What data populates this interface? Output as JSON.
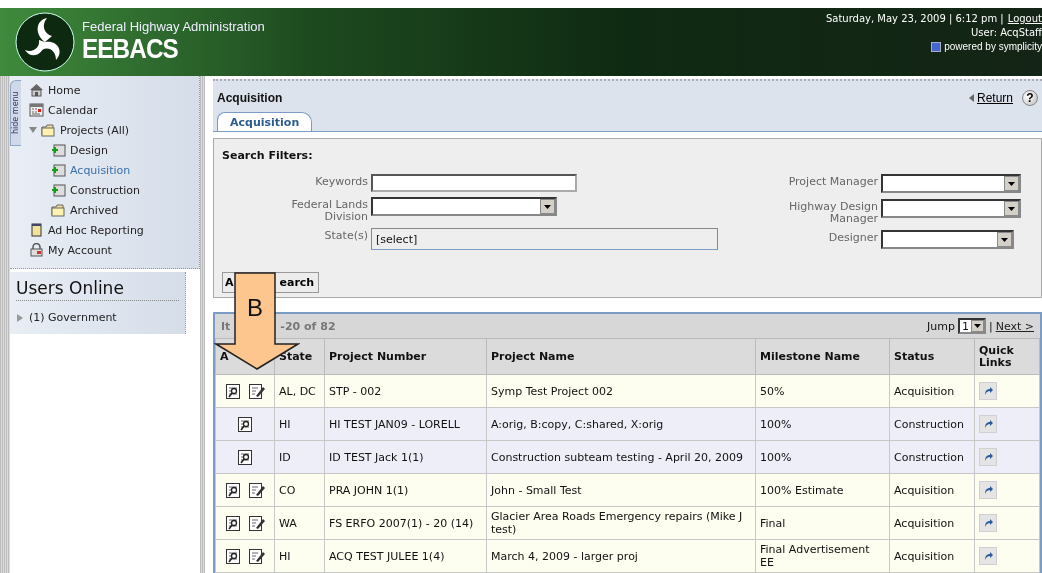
{
  "header": {
    "agency": "Federal Highway Administration",
    "app_name": "EEBACS",
    "datetime": "Saturday, May 23, 2009 | 6:12 pm |",
    "logout": "Logout",
    "user": "User: AcqStaff",
    "powered_by": "powered by symplicity"
  },
  "sidebar": {
    "hide_tab": "hide menu",
    "items": [
      {
        "label": "Home",
        "kind": "home",
        "selected": false
      },
      {
        "label": "Calendar",
        "kind": "calendar",
        "selected": false
      },
      {
        "label": "Projects (All)",
        "kind": "folder",
        "selected": false,
        "expanded": true,
        "children": [
          {
            "label": "Design",
            "kind": "add",
            "selected": false
          },
          {
            "label": "Acquisition",
            "kind": "add",
            "selected": true
          },
          {
            "label": "Construction",
            "kind": "add",
            "selected": false
          },
          {
            "label": "Archived",
            "kind": "folder",
            "selected": false
          }
        ]
      },
      {
        "label": "Ad Hoc Reporting",
        "kind": "notepad",
        "selected": false
      },
      {
        "label": "My Account",
        "kind": "lock",
        "selected": false
      }
    ],
    "users_online": {
      "title": "Users Online",
      "groups": [
        {
          "label": "(1) Government",
          "expanded": false
        }
      ]
    }
  },
  "page": {
    "title": "Acquisition",
    "return_link": "Return",
    "help_glyph": "?"
  },
  "tabs": [
    {
      "label": "Acquisition",
      "selected": true
    }
  ],
  "search_filters": {
    "title": "Search Filters:",
    "left_fields": [
      {
        "label": "Keywords",
        "kind": "text"
      },
      {
        "label": "Federal Lands Division",
        "kind": "select"
      },
      {
        "label": "State(s)",
        "kind": "picker",
        "value": "[select]"
      }
    ],
    "right_fields": [
      {
        "label": "Project Manager",
        "kind": "select"
      },
      {
        "label": "Highway Design Manager",
        "kind": "select"
      },
      {
        "label": "Designer",
        "kind": "select"
      }
    ],
    "button_visible_parts": [
      "A",
      "earch"
    ]
  },
  "results": {
    "range_visible_parts": [
      "It",
      "-20 of 82"
    ],
    "jump_label": "Jump",
    "jump_value": "1",
    "jump_separator": "|",
    "next_link": "Next >",
    "columns": [
      "A",
      "State",
      "Project Number",
      "Project Name",
      "Milestone Name",
      "Status",
      "Quick Links"
    ],
    "rows": [
      {
        "can_edit": true,
        "shaded": false,
        "state": "AL, DC",
        "project_number": "STP - 002",
        "project_name": "Symp Test Project 002",
        "milestone": "50%",
        "status": "Acquisition"
      },
      {
        "can_edit": false,
        "shaded": true,
        "state": "HI",
        "project_number": "HI TEST JAN09 - LORELL",
        "project_name": "A:orig, B:copy, C:shared, X:orig",
        "milestone": "100%",
        "status": "Construction"
      },
      {
        "can_edit": false,
        "shaded": true,
        "state": "ID",
        "project_number": "ID TEST Jack 1(1)",
        "project_name": "Construction subteam testing - April 20, 2009",
        "milestone": "100%",
        "status": "Construction"
      },
      {
        "can_edit": true,
        "shaded": false,
        "state": "CO",
        "project_number": "PRA JOHN 1(1)",
        "project_name": "John - Small Test",
        "milestone": "100% Estimate",
        "status": "Acquisition"
      },
      {
        "can_edit": true,
        "shaded": false,
        "state": "WA",
        "project_number": "FS ERFO 2007(1) - 20 (14)",
        "project_name": "Glacier Area Roads Emergency repairs (Mike J test)",
        "milestone": "Final",
        "status": "Acquisition"
      },
      {
        "can_edit": true,
        "shaded": false,
        "state": "HI",
        "project_number": "ACQ TEST JULEE 1(4)",
        "project_name": "March 4, 2009 - larger proj",
        "milestone": "Final Advertisement EE",
        "status": "Acquisition"
      }
    ]
  },
  "callout": {
    "label": "B"
  }
}
